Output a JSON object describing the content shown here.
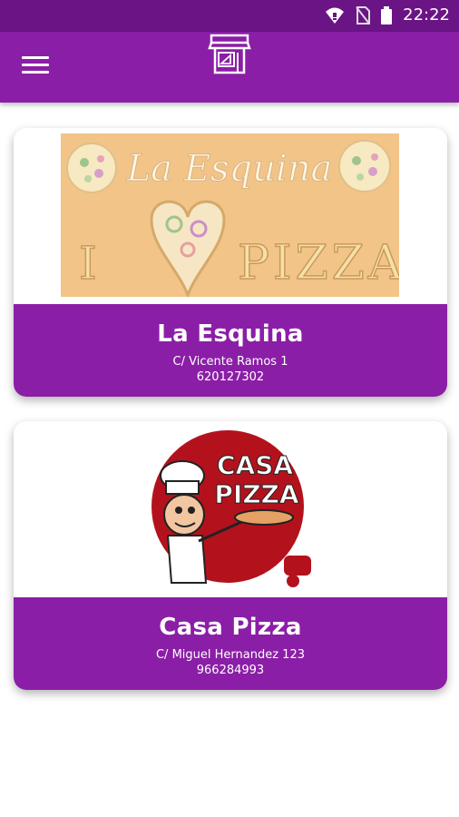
{
  "status_bar": {
    "time": "22:22",
    "icons": [
      "wifi-icon",
      "no-sim-icon",
      "battery-icon"
    ]
  },
  "app_bar": {
    "menu_icon": "hamburger-menu-icon",
    "logo_icon": "storefront-pizza-icon"
  },
  "colors": {
    "status_bar": "#6a1486",
    "app_bar": "#8b1ea6",
    "card_footer": "#8b1ea6",
    "banner_bg": "#f2c488"
  },
  "restaurants": [
    {
      "name": "La Esquina",
      "address": "C/ Vicente Ramos 1",
      "phone": "620127302",
      "logo": {
        "line1": "La Esquina",
        "line2_left": "I",
        "line2_right": "PIZZA"
      }
    },
    {
      "name": "Casa Pizza",
      "address": "C/ Miguel Hernandez 123",
      "phone": "966284993",
      "logo": {
        "line1": "CASA",
        "line2": "PIZZA"
      }
    }
  ]
}
